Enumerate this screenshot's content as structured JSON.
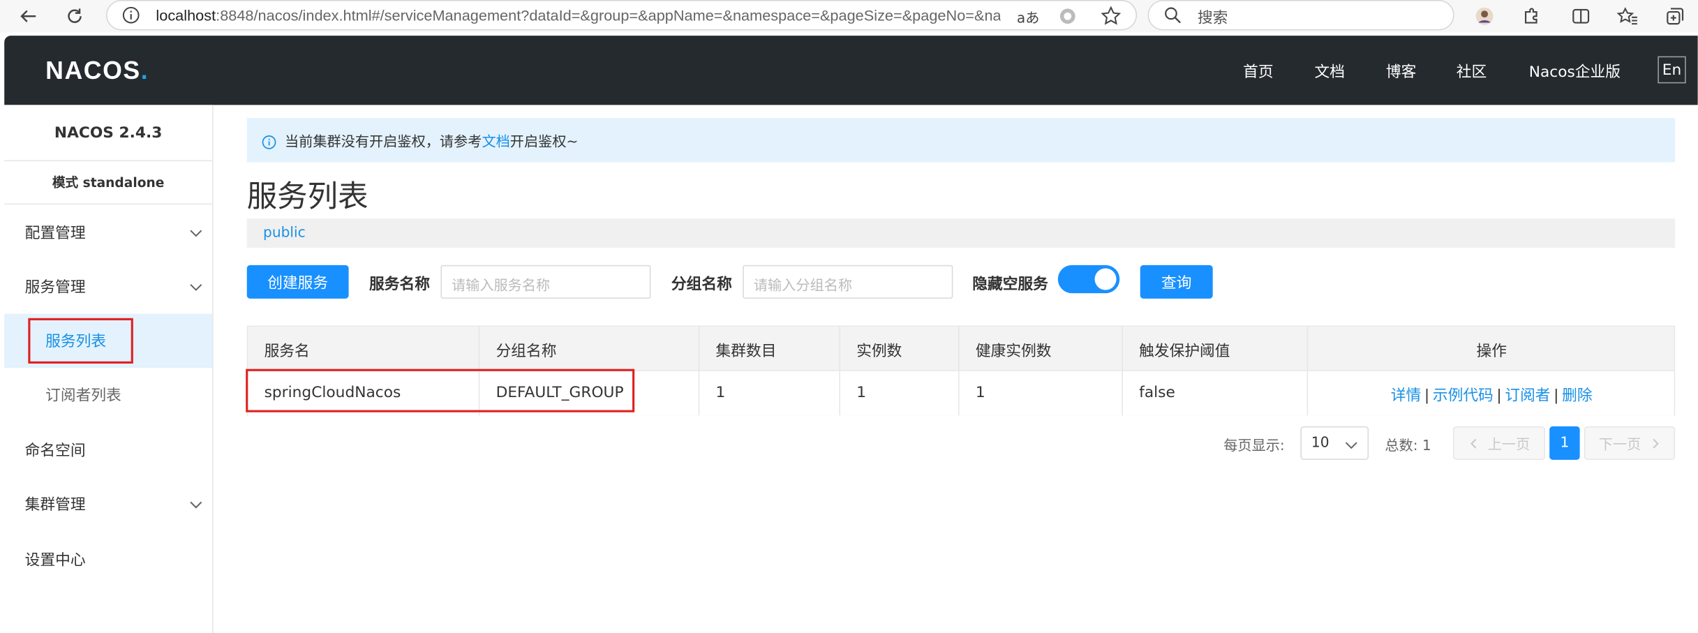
{
  "browser": {
    "url_host": "localhost",
    "url_rest": ":8848/nacos/index.html#/serviceManagement?dataId=&group=&appName=&namespace=&pageSize=&pageNo=&na...",
    "search_placeholder": "搜索",
    "read_aloud_label": "aあ"
  },
  "topnav": {
    "logo_prefix": "NACOS",
    "logo_dot": ".",
    "items": [
      "首页",
      "文档",
      "博客",
      "社区",
      "Nacos企业版"
    ],
    "lang": "En"
  },
  "sidebar": {
    "version": "NACOS 2.4.3",
    "mode": "模式 standalone",
    "items": [
      {
        "label": "配置管理"
      },
      {
        "label": "服务管理"
      },
      {
        "label": "服务列表"
      },
      {
        "label": "订阅者列表"
      },
      {
        "label": "命名空间"
      },
      {
        "label": "集群管理"
      },
      {
        "label": "设置中心"
      }
    ]
  },
  "notice": {
    "before": "当前集群没有开启鉴权，请参考",
    "link": "文档",
    "after": "开启鉴权~"
  },
  "page": {
    "title": "服务列表",
    "namespace": "public"
  },
  "filters": {
    "create_button": "创建服务",
    "service_name_label": "服务名称",
    "service_name_placeholder": "请输入服务名称",
    "group_name_label": "分组名称",
    "group_name_placeholder": "请输入分组名称",
    "hide_empty_label": "隐藏空服务",
    "hide_empty_on": true,
    "query_button": "查询"
  },
  "table": {
    "headers": [
      "服务名",
      "分组名称",
      "集群数目",
      "实例数",
      "健康实例数",
      "触发保护阈值",
      "操作"
    ],
    "rows": [
      {
        "service": "springCloudNacos",
        "group": "DEFAULT_GROUP",
        "clusters": "1",
        "instances": "1",
        "healthy": "1",
        "threshold": "false",
        "ops": [
          "详情",
          "示例代码",
          "订阅者",
          "删除"
        ]
      }
    ]
  },
  "pagination": {
    "page_size_label": "每页显示:",
    "page_size": "10",
    "total_label": "总数: 1",
    "prev": "上一页",
    "current": "1",
    "next": "下一页"
  },
  "colors": {
    "primary": "#1890ff",
    "nav_bg": "#252a2f",
    "highlight": "#e02020"
  }
}
